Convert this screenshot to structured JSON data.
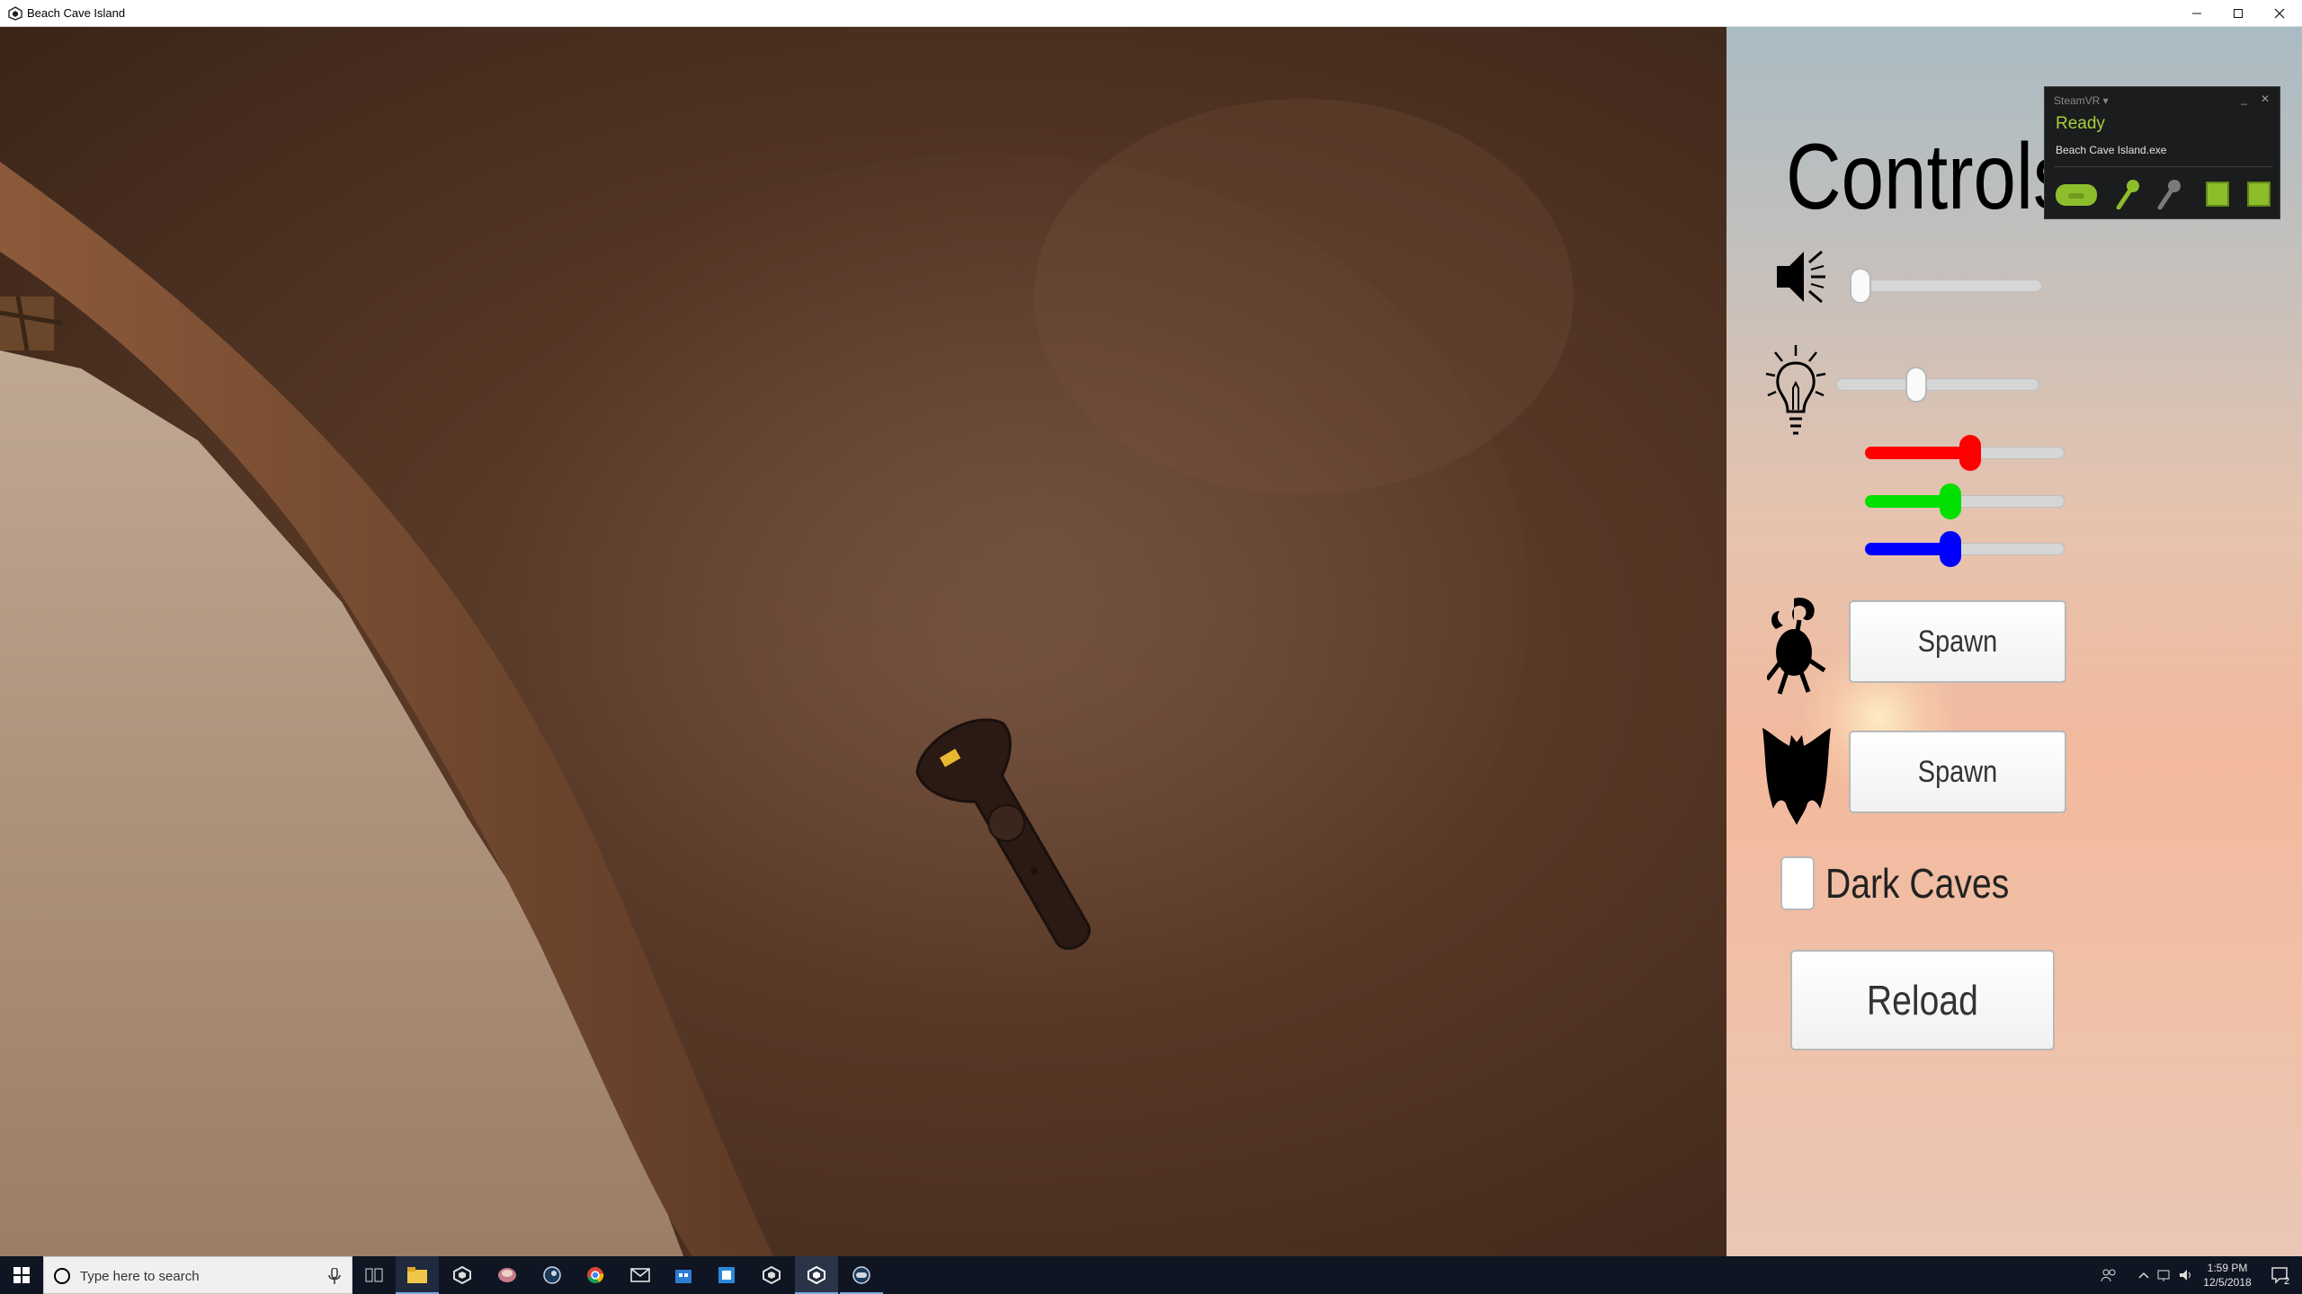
{
  "window": {
    "title": "Beach Cave Island"
  },
  "panel": {
    "title": "Controls",
    "volume_slider": {
      "value": 0.0
    },
    "brightness_slider": {
      "value": 0.38
    },
    "red_slider": {
      "value": 0.53,
      "color": "#ff0000"
    },
    "green_slider": {
      "value": 0.42,
      "color": "#00e000"
    },
    "blue_slider": {
      "value": 0.42,
      "color": "#0000ff"
    },
    "spawn_crab_label": "Spawn",
    "spawn_bat_label": "Spawn",
    "dark_caves": {
      "label": "Dark Caves",
      "checked": false
    },
    "reload_label": "Reload"
  },
  "steamvr": {
    "header": "SteamVR ▾",
    "minimize": "_",
    "close": "✕",
    "status": "Ready",
    "app": "Beach Cave Island.exe",
    "accent": "#a5d13b"
  },
  "taskbar": {
    "search_placeholder": "Type here to search",
    "time": "1:59 PM",
    "date": "12/5/2018",
    "notification_count": "2"
  }
}
